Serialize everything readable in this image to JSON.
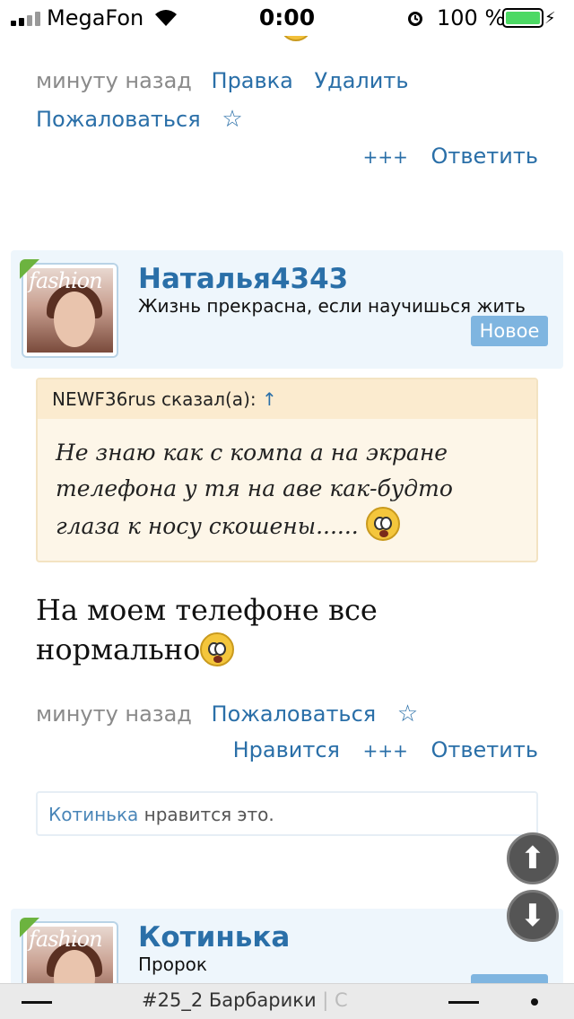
{
  "status_bar": {
    "carrier": "MegaFon",
    "time": "0:00",
    "battery_percent": "100 %",
    "battery_level": 1.0,
    "icons": [
      "signal-icon",
      "wifi-icon",
      "alarm-icon",
      "battery-icon",
      "charging-icon"
    ]
  },
  "previous_post": {
    "time": "минуту назад",
    "edit": "Правка",
    "delete": "Удалить",
    "report": "Пожаловаться",
    "star": "☆",
    "plus": "+++",
    "reply": "Ответить"
  },
  "post": {
    "author": "Наталья4343",
    "author_title": "Жизнь прекрасна, если научишься жить",
    "badge": "Новое",
    "quote_author": "NEWF36rus сказал(а):",
    "quote_arrow": "↑",
    "quote_text": "Не знаю как с компа а на экране телефона у тя на аве как-будто глаза к носу скошены......",
    "message": "На моем телефоне все нормально",
    "time": "минуту назад",
    "report": "Пожаловаться",
    "star": "☆",
    "like": "Нравится",
    "plus": "+++",
    "reply": "Ответить",
    "likes_user": "Котинька",
    "likes_suffix": "нравится это."
  },
  "next_post": {
    "author": "Котинька",
    "author_title": "Пророк"
  },
  "bottom_bar": {
    "title": "#25_2 Барбарики",
    "title_tail": "| С"
  },
  "colors": {
    "link": "#2a6fa8",
    "card_bg": "#eef6fc",
    "badge": "#7fb5e0",
    "quote_bg": "#fdf6e8"
  }
}
